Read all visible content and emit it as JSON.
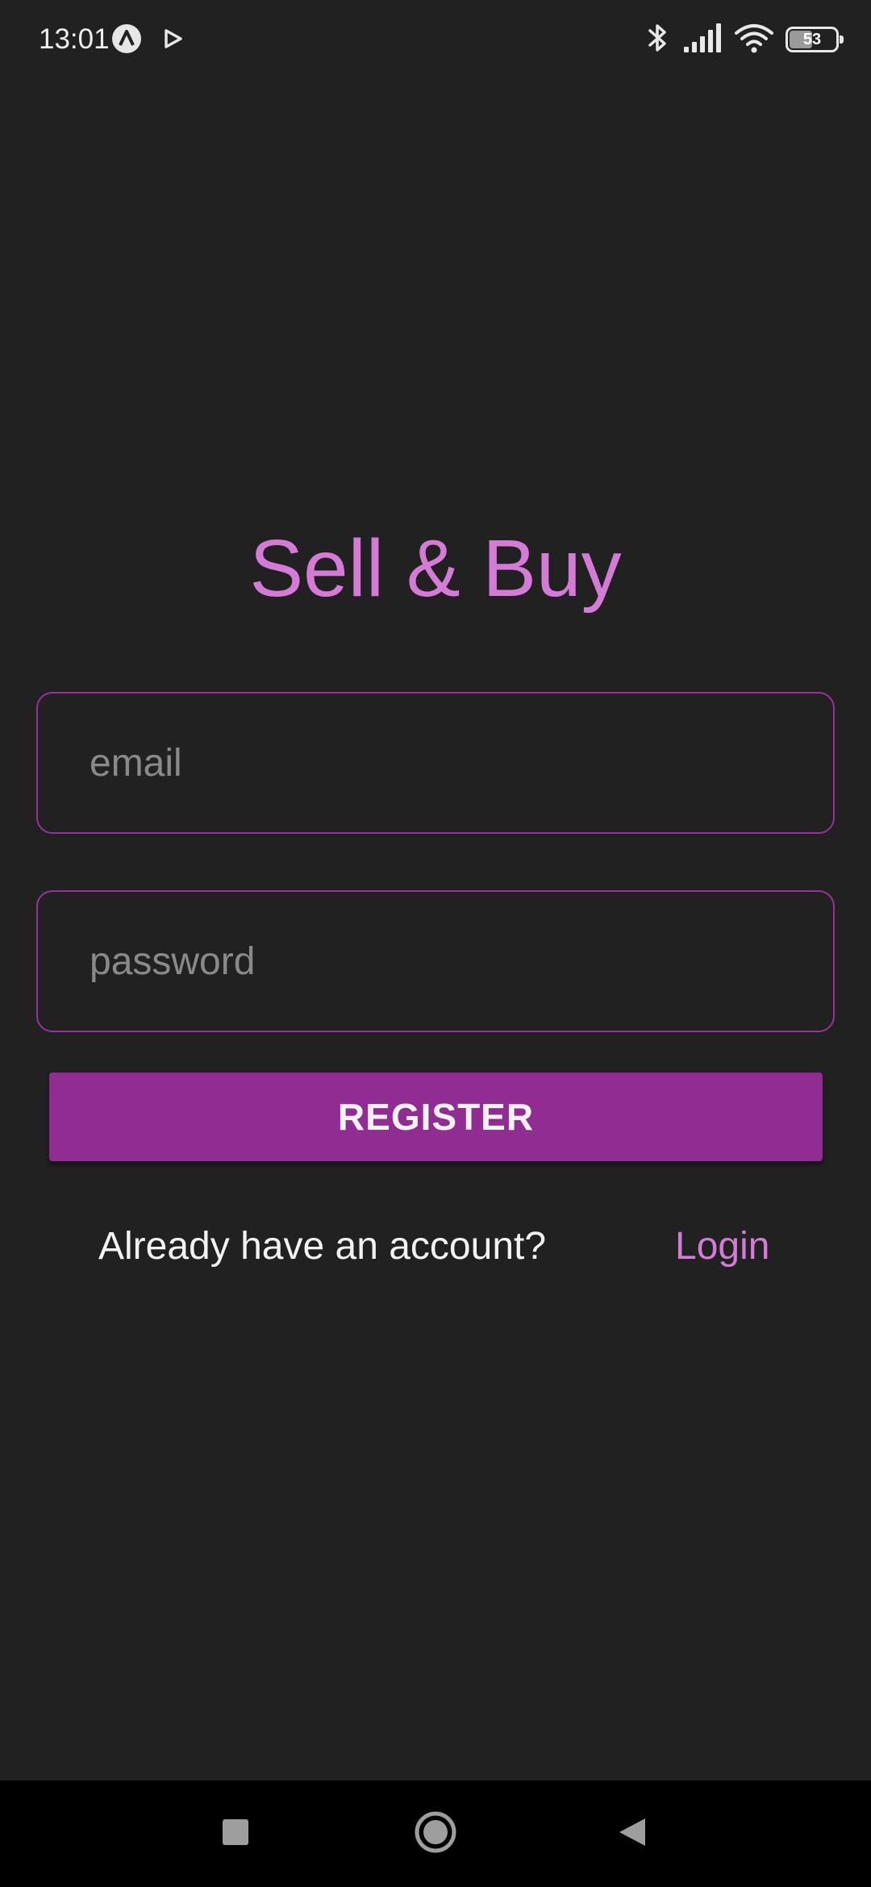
{
  "status_bar": {
    "time": "13:01",
    "battery_level": "53",
    "icons": [
      "app-badge-icon",
      "play-store-icon",
      "bluetooth-icon",
      "signal-icon",
      "wifi-icon",
      "battery-icon"
    ]
  },
  "app": {
    "title": "Sell & Buy"
  },
  "form": {
    "email": {
      "value": "",
      "placeholder": "email"
    },
    "password": {
      "value": "",
      "placeholder": "password"
    },
    "register_label": "REGISTER"
  },
  "footer": {
    "prompt": "Already have an account?",
    "login_label": "Login"
  },
  "nav_bar": {
    "icons": [
      "recent-apps-icon",
      "home-icon",
      "back-icon"
    ]
  },
  "colors": {
    "background": "#212121",
    "accent": "#d67ad8",
    "input_border": "#9b2fa1",
    "button": "#912d92"
  }
}
